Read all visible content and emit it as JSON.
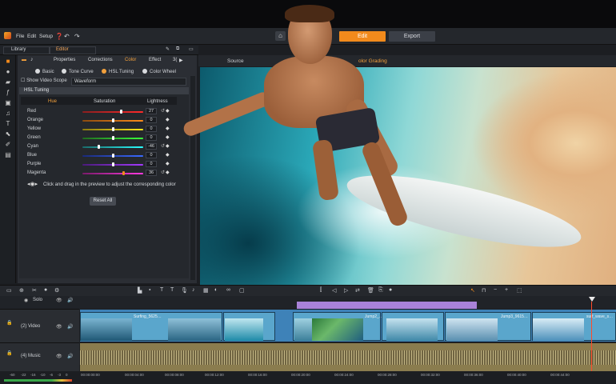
{
  "menu": {
    "file": "File",
    "edit": "Edit",
    "setup": "Setup"
  },
  "modes": {
    "edit": "Edit",
    "export": "Export"
  },
  "left_tabs": {
    "library": "Library",
    "editor": "Editor"
  },
  "sub_tabs": {
    "properties": "Properties",
    "corrections": "Corrections",
    "color": "Color",
    "effect": "Effect",
    "more": "3("
  },
  "color_modes": {
    "basic": "Basic",
    "tone_curve": "Tone Curve",
    "hsl_tuning": "HSL Tuning",
    "color_wheel": "Color Wheel",
    "active": "HSL Tuning"
  },
  "scope": {
    "label": "Show Video Scope",
    "value": "Waveform"
  },
  "hsl": {
    "header": "HSL Tuning",
    "columns": {
      "hue": "Hue",
      "saturation": "Saturation",
      "lightness": "Lightness"
    },
    "rows": [
      {
        "name": "Red",
        "value": "27"
      },
      {
        "name": "Orange",
        "value": "0"
      },
      {
        "name": "Yellow",
        "value": "0"
      },
      {
        "name": "Green",
        "value": "0"
      },
      {
        "name": "Cyan",
        "value": "-46"
      },
      {
        "name": "Blue",
        "value": "0"
      },
      {
        "name": "Purple",
        "value": "0"
      },
      {
        "name": "Magenta",
        "value": "36"
      }
    ],
    "hint": "Click and drag in the preview to adjust the corresponding color",
    "reset_all": "Reset All"
  },
  "preview_tabs": {
    "source": "Source",
    "color_grading": "olor Grading"
  },
  "timeline": {
    "solo": "Solo",
    "tracks": {
      "video": "(2) Video",
      "music": "(4) Music"
    },
    "clips": [
      "Surfing_5625…",
      "Jump2_…",
      "Jump3_9615…",
      "surf_wave_s…"
    ],
    "timecodes": [
      "00:00:00:00",
      "00:00:04:00",
      "00:00:08:00",
      "00:00:12:00",
      "00:00:16:00",
      "00:00:20:00",
      "00:00:24:00",
      "00:00:28:00",
      "00:00:32:00",
      "00:00:36:00",
      "00:00:40:00",
      "00:00:44:00"
    ],
    "db_scale": [
      "-60",
      "-22",
      "-16",
      "-10",
      "-6",
      "-3",
      "0"
    ]
  },
  "colors": {
    "accent": "#f28a1c",
    "clip_blue": "#5aa6cc",
    "audio": "#8a7c4e",
    "selection": "#a982d9"
  }
}
